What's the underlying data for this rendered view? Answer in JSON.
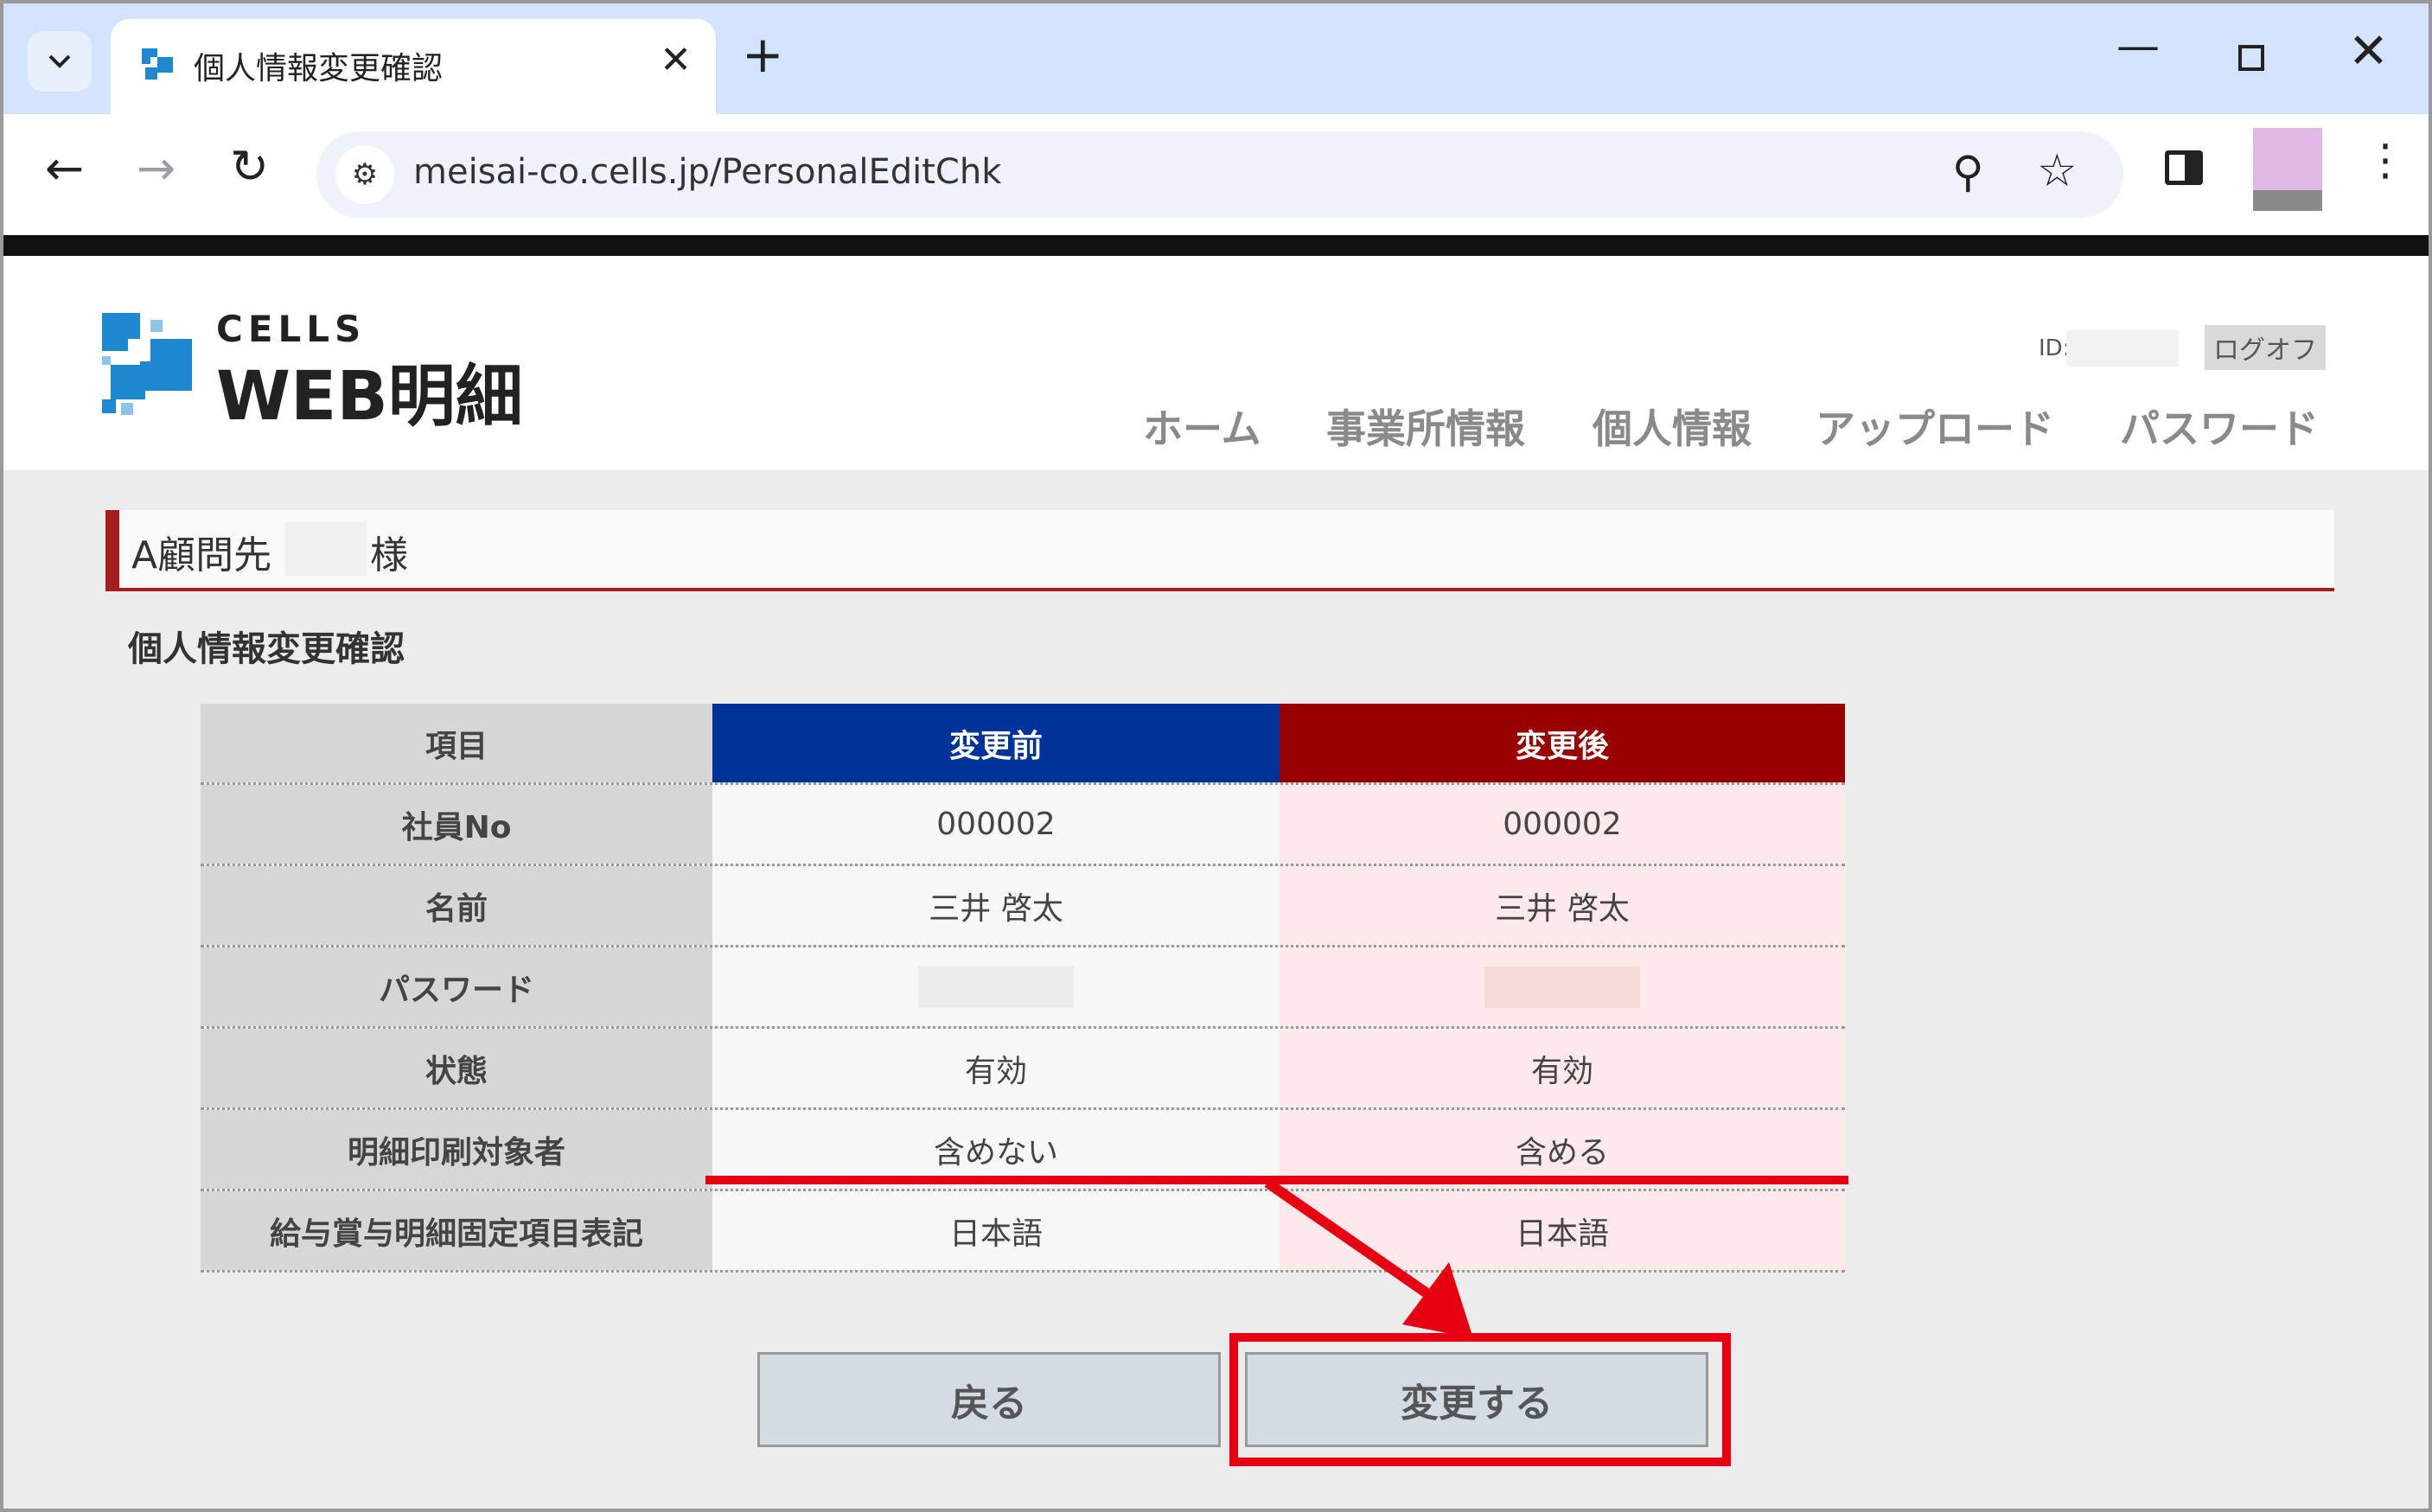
{
  "browser": {
    "tab_title": "個人情報変更確認",
    "tab_close": "✕",
    "new_tab": "+",
    "url": "meisai-co.cells.jp/PersonalEditChk",
    "window_controls": {
      "minimize": "—",
      "close": "✕"
    },
    "icons": [
      "tab-search-icon",
      "back-arrow-icon",
      "forward-arrow-icon",
      "reload-icon",
      "site-info-icon",
      "zoom-icon",
      "bookmark-star-icon",
      "side-panel-icon",
      "profile-avatar",
      "menu-kebab-icon"
    ]
  },
  "header": {
    "logo_top": "CELLS",
    "logo_main": "WEB明細",
    "id_label": "ID:",
    "logoff_label": "ログオフ",
    "nav": [
      "ホーム",
      "事業所情報",
      "個人情報",
      "アップロード",
      "パスワード"
    ]
  },
  "client": {
    "name": "A顧問先",
    "suffix": "様"
  },
  "page_title": "個人情報変更確認",
  "table": {
    "headers": [
      "項目",
      "変更前",
      "変更後"
    ],
    "rows": [
      {
        "item": "社員No",
        "before": "000002",
        "after": "000002"
      },
      {
        "item": "名前",
        "before": "三井 啓太",
        "after": "三井 啓太"
      },
      {
        "item": "パスワード",
        "before": "",
        "after": ""
      },
      {
        "item": "状態",
        "before": "有効",
        "after": "有効"
      },
      {
        "item": "明細印刷対象者",
        "before": "含めない",
        "after": "含める"
      },
      {
        "item": "給与賞与明細固定項目表記",
        "before": "日本語",
        "after": "日本語"
      }
    ]
  },
  "buttons": {
    "back": "戻る",
    "change": "変更する"
  },
  "colors": {
    "before_header": "#003399",
    "after_header": "#990000",
    "accent_red": "#e60012",
    "client_bar": "#a41e1e"
  }
}
